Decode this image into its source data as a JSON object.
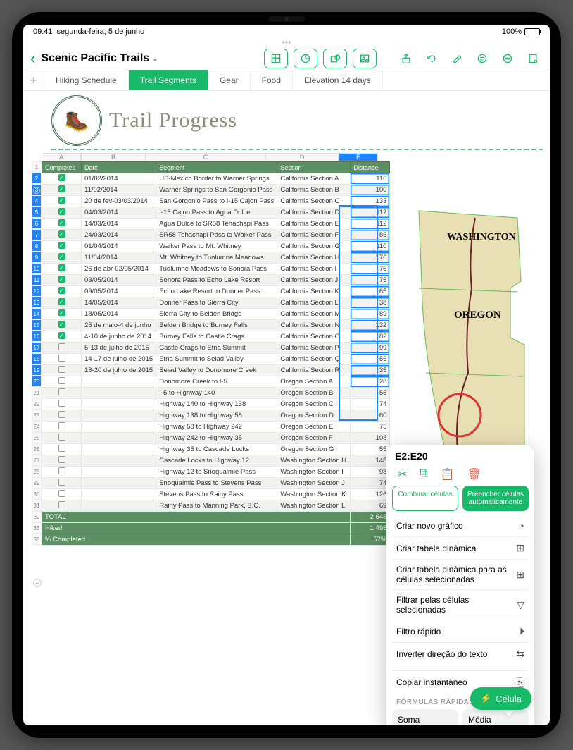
{
  "status": {
    "time": "09:41",
    "date": "segunda-feira, 5 de junho",
    "battery": "100%"
  },
  "doc_title": "Scenic Pacific Trails",
  "sheet_tabs": [
    "Hiking Schedule",
    "Trail Segments",
    "Gear",
    "Food",
    "Elevation 14 days"
  ],
  "active_tab_index": 1,
  "heading": "Trail Progress",
  "columns_letters": [
    "A",
    "B",
    "C",
    "D",
    "E"
  ],
  "headers": {
    "A": "Completed",
    "B": "Date",
    "C": "Segment",
    "D": "Section",
    "E": "Distance"
  },
  "selection_label": "E2:E20",
  "rows": [
    {
      "n": 2,
      "done": true,
      "date": "01/02/2014",
      "seg": "US-Mexico Border to Warner Springs",
      "sec": "California Section A",
      "dist": "110"
    },
    {
      "n": 3,
      "done": true,
      "date": "11/02/2014",
      "seg": "Warner Springs to San Gorgonio Pass",
      "sec": "California Section B",
      "dist": "100"
    },
    {
      "n": 4,
      "done": true,
      "date": "20 de fev-03/03/2014",
      "seg": "San Gorgonio Pass to I-15 Cajon Pass",
      "sec": "California Section C",
      "dist": "133"
    },
    {
      "n": 5,
      "done": true,
      "date": "04/03/2014",
      "seg": "I-15 Cajon Pass to Agua Dulce",
      "sec": "California Section D",
      "dist": "112"
    },
    {
      "n": 6,
      "done": true,
      "date": "14/03/2014",
      "seg": "Agua Dulce to SR58 Tehachapi Pass",
      "sec": "California Section E",
      "dist": "112"
    },
    {
      "n": 7,
      "done": true,
      "date": "24/03/2014",
      "seg": "SR58 Tehachapi Pass to Walker Pass",
      "sec": "California Section F",
      "dist": "86"
    },
    {
      "n": 8,
      "done": true,
      "date": "01/04/2014",
      "seg": "Walker Pass to Mt. Whitney",
      "sec": "California Section G",
      "dist": "110"
    },
    {
      "n": 9,
      "done": true,
      "date": "11/04/2014",
      "seg": "Mt. Whitney to Tuolumne Meadows",
      "sec": "California Section H",
      "dist": "176"
    },
    {
      "n": 10,
      "done": true,
      "date": "26 de abr-02/05/2014",
      "seg": "Tuolumne Meadows to Sonora Pass",
      "sec": "California Section I",
      "dist": "75"
    },
    {
      "n": 11,
      "done": true,
      "date": "03/05/2014",
      "seg": "Sonora Pass to Echo Lake Resort",
      "sec": "California Section J",
      "dist": "75"
    },
    {
      "n": 12,
      "done": true,
      "date": "09/05/2014",
      "seg": "Echo Lake Resort to Donner Pass",
      "sec": "California Section K",
      "dist": "65"
    },
    {
      "n": 13,
      "done": true,
      "date": "14/05/2014",
      "seg": "Donner Pass to Sierra City",
      "sec": "California Section L",
      "dist": "38"
    },
    {
      "n": 14,
      "done": true,
      "date": "18/05/2014",
      "seg": "Sierra City to Belden Bridge",
      "sec": "California Section M",
      "dist": "89"
    },
    {
      "n": 15,
      "done": true,
      "date": "25 de maio-4 de junho",
      "seg": "Belden Bridge to Burney Falls",
      "sec": "California Section N",
      "dist": "132"
    },
    {
      "n": 16,
      "done": true,
      "date": "4-10 de junho de 2014",
      "seg": "Burney Falls to Castle Crags",
      "sec": "California Section O",
      "dist": "82"
    },
    {
      "n": 17,
      "done": false,
      "date": "5-13 de julho de 2015",
      "seg": "Castle Crags to Etna Summit",
      "sec": "California Section P",
      "dist": "99"
    },
    {
      "n": 18,
      "done": false,
      "date": "14-17 de julho de 2015",
      "seg": "Etna Summit to Seiad Valley",
      "sec": "California Section Q",
      "dist": "56"
    },
    {
      "n": 19,
      "done": false,
      "date": "18-20 de julho de 2015",
      "seg": "Seiad Valley to Donomore Creek",
      "sec": "California Section R",
      "dist": "35"
    },
    {
      "n": 20,
      "done": false,
      "date": "",
      "seg": "Donomore Creek to I-5",
      "sec": "Oregon Section A",
      "dist": "28"
    },
    {
      "n": 21,
      "done": false,
      "date": "",
      "seg": "I-5 to Highway 140",
      "sec": "Oregon Section B",
      "dist": "55"
    },
    {
      "n": 22,
      "done": false,
      "date": "",
      "seg": "Highway 140 to Highway 138",
      "sec": "Oregon Section C",
      "dist": "74"
    },
    {
      "n": 23,
      "done": false,
      "date": "",
      "seg": "Highway 138 to Highway 58",
      "sec": "Oregon Section D",
      "dist": "60"
    },
    {
      "n": 24,
      "done": false,
      "date": "",
      "seg": "Highway 58 to Highway 242",
      "sec": "Oregon Section E",
      "dist": "75"
    },
    {
      "n": 25,
      "done": false,
      "date": "",
      "seg": "Highway 242 to Highway 35",
      "sec": "Oregon Section F",
      "dist": "108"
    },
    {
      "n": 26,
      "done": false,
      "date": "",
      "seg": "Highway 35 to Cascade Locks",
      "sec": "Oregon Section G",
      "dist": "55"
    },
    {
      "n": 27,
      "done": false,
      "date": "",
      "seg": "Cascade Locks to Highway 12",
      "sec": "Washington Section H",
      "dist": "148"
    },
    {
      "n": 28,
      "done": false,
      "date": "",
      "seg": "Highway 12 to Snoqualmie Pass",
      "sec": "Washington Section I",
      "dist": "98"
    },
    {
      "n": 29,
      "done": false,
      "date": "",
      "seg": "Snoqualmie Pass to Stevens Pass",
      "sec": "Washington Section J",
      "dist": "74"
    },
    {
      "n": 30,
      "done": false,
      "date": "",
      "seg": "Stevens Pass to Rainy Pass",
      "sec": "Washington Section K",
      "dist": "126"
    },
    {
      "n": 31,
      "done": false,
      "date": "",
      "seg": "Rainy Pass to Manning Park, B.C.",
      "sec": "Washington Section L",
      "dist": "69"
    }
  ],
  "summary": {
    "total_label": "TOTAL",
    "total_val": "2 645",
    "hiked_label": "Hiked",
    "hiked_val": "1 495",
    "pct_label": "% Completed",
    "pct_val": "57%"
  },
  "map_labels": {
    "wa": "WASHINGTON",
    "or": "OREGON"
  },
  "popover": {
    "merge": "Combinar células",
    "autofill": "Preencher células automaticamente",
    "items": [
      "Criar novo gráfico",
      "Criar tabela dinâmica",
      "Criar tabela dinâmica para as células selecionadas",
      "Filtrar pelas células selecionadas",
      "Filtro rápido",
      "Inverter direção do texto",
      "Copiar instantâneo"
    ],
    "formulas_header": "FÓRMULAS RÁPIDAS",
    "sum": "Soma",
    "avg": "Média"
  },
  "fab_label": "Célula"
}
